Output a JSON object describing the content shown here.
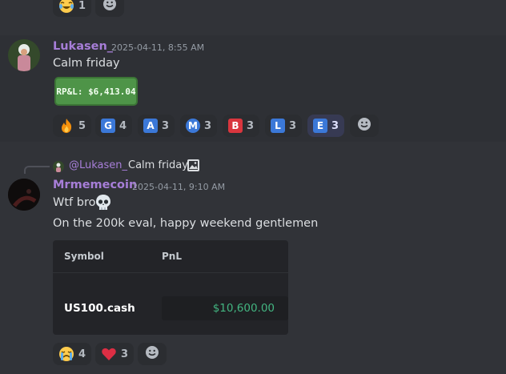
{
  "top_reactions": [
    {
      "emoji": "laughing-crying-emoji",
      "count": "1"
    }
  ],
  "message1": {
    "username": "Lukasen_",
    "timestamp": "2025-04-11, 8:55 AM",
    "text": "Calm friday",
    "badge": "RP&L: $6,413.04",
    "reactions": [
      {
        "type": "emoji",
        "emoji": "fire-emoji",
        "count": "5",
        "mine": false
      },
      {
        "type": "letter",
        "letter": "G",
        "color": "#3b78d8",
        "count": "4",
        "mine": false
      },
      {
        "type": "letter",
        "letter": "A",
        "color": "#3b78d8",
        "count": "3",
        "mine": false
      },
      {
        "type": "letter",
        "letter": "M",
        "color": "#3b78d8",
        "count": "3",
        "mine": false
      },
      {
        "type": "letter",
        "letter": "B",
        "color": "#d9363e",
        "count": "3",
        "mine": false
      },
      {
        "type": "letter",
        "letter": "L",
        "color": "#3b78d8",
        "count": "3",
        "mine": false
      },
      {
        "type": "letter",
        "letter": "E",
        "color": "#3b78d8",
        "count": "3",
        "mine": true
      }
    ]
  },
  "message2": {
    "reply": {
      "mention": "@Lukasen_",
      "text": "Calm friday"
    },
    "username": "Mrmemecoin",
    "timestamp": "2025-04-11, 9:10 AM",
    "line1": "Wtf bro",
    "line2": "On the 200k eval, happy weekend gentlemen",
    "table": {
      "headers": [
        "Symbol",
        "PnL"
      ],
      "rows": [
        [
          "US100.cash",
          "$10,600.00"
        ]
      ]
    },
    "reactions": [
      {
        "emoji": "crying-emoji",
        "count": "4"
      },
      {
        "emoji": "red-heart-emoji",
        "count": "3"
      }
    ]
  },
  "colors": {
    "username": "#a77ed8",
    "pnl": "#43b581",
    "badge": "#4e9448"
  }
}
